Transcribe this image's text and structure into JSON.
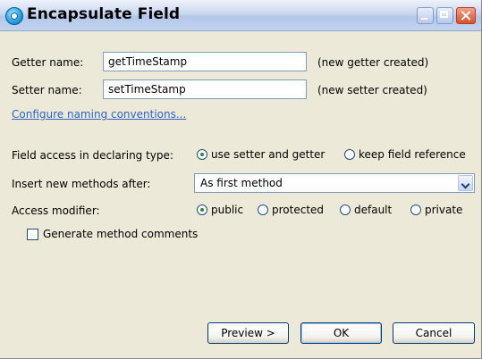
{
  "window": {
    "title": "Encapsulate Field"
  },
  "getter": {
    "label": "Getter name:",
    "value": "getTimeStamp",
    "note": "(new getter created)"
  },
  "setter": {
    "label": "Setter name:",
    "value": "setTimeStamp",
    "note": "(new setter created)"
  },
  "naming_link": "Configure naming conventions...",
  "field_access": {
    "label": "Field access in declaring type:",
    "options": [
      {
        "label": "use setter and getter",
        "selected": true
      },
      {
        "label": "keep field reference",
        "selected": false
      }
    ]
  },
  "insert_after": {
    "label": "Insert new methods after:",
    "value": "As first method"
  },
  "access_modifier": {
    "label": "Access modifier:",
    "options": [
      {
        "label": "public",
        "selected": true
      },
      {
        "label": "protected",
        "selected": false
      },
      {
        "label": "default",
        "selected": false
      },
      {
        "label": "private",
        "selected": false
      }
    ]
  },
  "generate_comments": {
    "label": "Generate method comments",
    "checked": false
  },
  "buttons": {
    "preview": "Preview >",
    "ok": "OK",
    "cancel": "Cancel"
  }
}
